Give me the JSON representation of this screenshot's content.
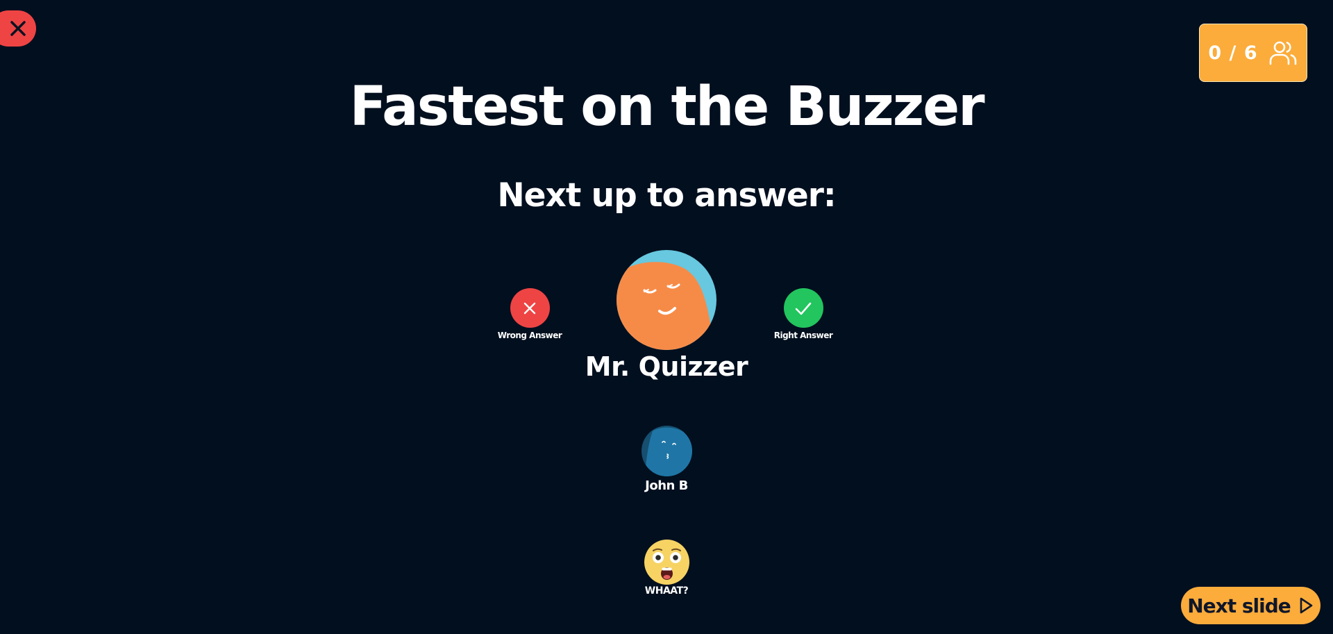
{
  "title": "Fastest on the Buzzer",
  "subtitle": "Next up to answer:",
  "counter": {
    "text": "0 / 6",
    "icon": "users-icon"
  },
  "close_button": {
    "icon": "close-icon"
  },
  "wrong_answer": {
    "label": "Wrong Answer",
    "icon": "x-icon",
    "color": "#ef4444"
  },
  "right_answer": {
    "label": "Right Answer",
    "icon": "check-icon",
    "color": "#22c55e"
  },
  "queue": [
    {
      "name": "Mr. Quizzer",
      "avatar": "orange-sleepy-face"
    },
    {
      "name": "John B",
      "avatar": "blue-kissing-face"
    },
    {
      "name": "WHAAT?",
      "avatar": "shocked-emoji-face"
    }
  ],
  "next_slide": {
    "label": "Next slide",
    "icon": "play-icon"
  },
  "colors": {
    "background": "#020f1f",
    "accent": "#fbac3b"
  }
}
